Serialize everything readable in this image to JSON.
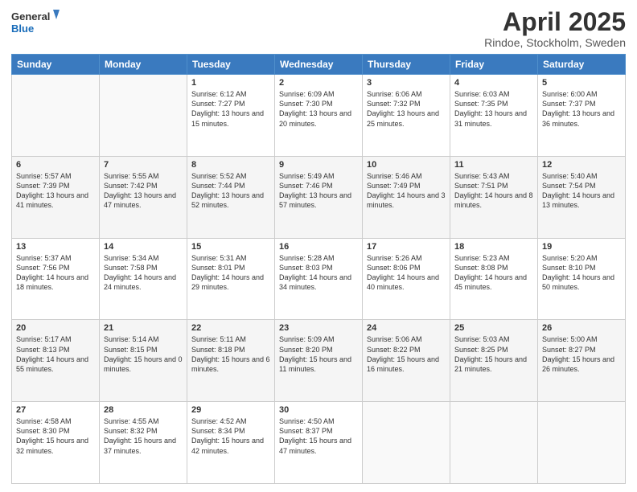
{
  "header": {
    "logo_line1": "General",
    "logo_line2": "Blue",
    "title": "April 2025",
    "subtitle": "Rindoe, Stockholm, Sweden"
  },
  "weekdays": [
    "Sunday",
    "Monday",
    "Tuesday",
    "Wednesday",
    "Thursday",
    "Friday",
    "Saturday"
  ],
  "weeks": [
    [
      {
        "day": "",
        "info": ""
      },
      {
        "day": "",
        "info": ""
      },
      {
        "day": "1",
        "info": "Sunrise: 6:12 AM\nSunset: 7:27 PM\nDaylight: 13 hours and 15 minutes."
      },
      {
        "day": "2",
        "info": "Sunrise: 6:09 AM\nSunset: 7:30 PM\nDaylight: 13 hours and 20 minutes."
      },
      {
        "day": "3",
        "info": "Sunrise: 6:06 AM\nSunset: 7:32 PM\nDaylight: 13 hours and 25 minutes."
      },
      {
        "day": "4",
        "info": "Sunrise: 6:03 AM\nSunset: 7:35 PM\nDaylight: 13 hours and 31 minutes."
      },
      {
        "day": "5",
        "info": "Sunrise: 6:00 AM\nSunset: 7:37 PM\nDaylight: 13 hours and 36 minutes."
      }
    ],
    [
      {
        "day": "6",
        "info": "Sunrise: 5:57 AM\nSunset: 7:39 PM\nDaylight: 13 hours and 41 minutes."
      },
      {
        "day": "7",
        "info": "Sunrise: 5:55 AM\nSunset: 7:42 PM\nDaylight: 13 hours and 47 minutes."
      },
      {
        "day": "8",
        "info": "Sunrise: 5:52 AM\nSunset: 7:44 PM\nDaylight: 13 hours and 52 minutes."
      },
      {
        "day": "9",
        "info": "Sunrise: 5:49 AM\nSunset: 7:46 PM\nDaylight: 13 hours and 57 minutes."
      },
      {
        "day": "10",
        "info": "Sunrise: 5:46 AM\nSunset: 7:49 PM\nDaylight: 14 hours and 3 minutes."
      },
      {
        "day": "11",
        "info": "Sunrise: 5:43 AM\nSunset: 7:51 PM\nDaylight: 14 hours and 8 minutes."
      },
      {
        "day": "12",
        "info": "Sunrise: 5:40 AM\nSunset: 7:54 PM\nDaylight: 14 hours and 13 minutes."
      }
    ],
    [
      {
        "day": "13",
        "info": "Sunrise: 5:37 AM\nSunset: 7:56 PM\nDaylight: 14 hours and 18 minutes."
      },
      {
        "day": "14",
        "info": "Sunrise: 5:34 AM\nSunset: 7:58 PM\nDaylight: 14 hours and 24 minutes."
      },
      {
        "day": "15",
        "info": "Sunrise: 5:31 AM\nSunset: 8:01 PM\nDaylight: 14 hours and 29 minutes."
      },
      {
        "day": "16",
        "info": "Sunrise: 5:28 AM\nSunset: 8:03 PM\nDaylight: 14 hours and 34 minutes."
      },
      {
        "day": "17",
        "info": "Sunrise: 5:26 AM\nSunset: 8:06 PM\nDaylight: 14 hours and 40 minutes."
      },
      {
        "day": "18",
        "info": "Sunrise: 5:23 AM\nSunset: 8:08 PM\nDaylight: 14 hours and 45 minutes."
      },
      {
        "day": "19",
        "info": "Sunrise: 5:20 AM\nSunset: 8:10 PM\nDaylight: 14 hours and 50 minutes."
      }
    ],
    [
      {
        "day": "20",
        "info": "Sunrise: 5:17 AM\nSunset: 8:13 PM\nDaylight: 14 hours and 55 minutes."
      },
      {
        "day": "21",
        "info": "Sunrise: 5:14 AM\nSunset: 8:15 PM\nDaylight: 15 hours and 0 minutes."
      },
      {
        "day": "22",
        "info": "Sunrise: 5:11 AM\nSunset: 8:18 PM\nDaylight: 15 hours and 6 minutes."
      },
      {
        "day": "23",
        "info": "Sunrise: 5:09 AM\nSunset: 8:20 PM\nDaylight: 15 hours and 11 minutes."
      },
      {
        "day": "24",
        "info": "Sunrise: 5:06 AM\nSunset: 8:22 PM\nDaylight: 15 hours and 16 minutes."
      },
      {
        "day": "25",
        "info": "Sunrise: 5:03 AM\nSunset: 8:25 PM\nDaylight: 15 hours and 21 minutes."
      },
      {
        "day": "26",
        "info": "Sunrise: 5:00 AM\nSunset: 8:27 PM\nDaylight: 15 hours and 26 minutes."
      }
    ],
    [
      {
        "day": "27",
        "info": "Sunrise: 4:58 AM\nSunset: 8:30 PM\nDaylight: 15 hours and 32 minutes."
      },
      {
        "day": "28",
        "info": "Sunrise: 4:55 AM\nSunset: 8:32 PM\nDaylight: 15 hours and 37 minutes."
      },
      {
        "day": "29",
        "info": "Sunrise: 4:52 AM\nSunset: 8:34 PM\nDaylight: 15 hours and 42 minutes."
      },
      {
        "day": "30",
        "info": "Sunrise: 4:50 AM\nSunset: 8:37 PM\nDaylight: 15 hours and 47 minutes."
      },
      {
        "day": "",
        "info": ""
      },
      {
        "day": "",
        "info": ""
      },
      {
        "day": "",
        "info": ""
      }
    ]
  ]
}
